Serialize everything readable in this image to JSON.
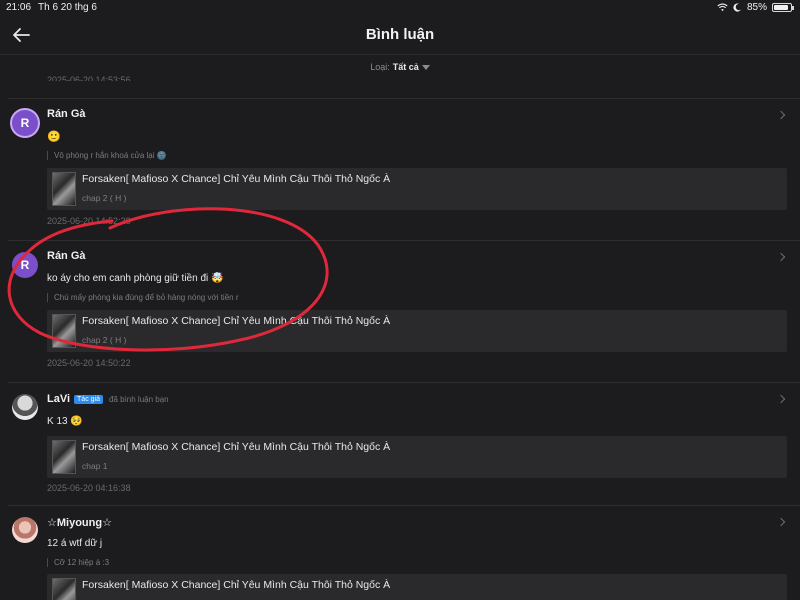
{
  "status_bar": {
    "time": "21:06",
    "date": "Th 6 20 thg 6",
    "battery": "85%"
  },
  "header": {
    "title": "Bình luận"
  },
  "filter": {
    "label": "Loại:",
    "value": "Tất cả"
  },
  "partial_timestamp": "2025-06-20 14:53:56",
  "comments": [
    {
      "name": "Rán Gà",
      "avatar_letter": "R",
      "text": "🙂",
      "quote": "Vô phòng r hắn khoá cửa lại 🌚",
      "story": "Forsaken[ Mafioso X Chance] Chỉ Yêu Mình Cậu Thôi Thỏ Ngốc À",
      "chapter": "chap 2 ( H )",
      "timestamp": "2025-06-20 14:52:28"
    },
    {
      "name": "Rán Gà",
      "avatar_letter": "R",
      "text": "ko áy cho em canh phòng giữ tiền đi 🤯",
      "quote": "Chú mấy phòng kia đúng để bỏ hàng nóng với tiền r",
      "story": "Forsaken[ Mafioso X Chance] Chỉ Yêu Mình Cậu Thôi Thỏ Ngốc À",
      "chapter": "chap 2 ( H )",
      "timestamp": "2025-06-20 14:50:22"
    },
    {
      "name": "LaVi",
      "badge": "Tác giả",
      "reply_note": "đã bình luận bạn",
      "text": "K 13 🥺",
      "story": "Forsaken[ Mafioso X Chance] Chỉ Yêu Mình Cậu Thôi Thỏ Ngốc À",
      "chapter": "chap 1",
      "timestamp": "2025-06-20 04:16:38"
    },
    {
      "name": "☆Miyoung☆",
      "text": "12 á wtf dữ j",
      "quote": "Cỡ 12 hiệp á :3",
      "story": "Forsaken[ Mafioso X Chance] Chỉ Yêu Mình Cậu Thôi Thỏ Ngốc À"
    }
  ],
  "colors": {
    "background": "#1c1c1e",
    "card": "#2a2a2c",
    "annotation": "#e0283a",
    "avatar": "#7b4fc9",
    "badge": "#2d8cf0"
  }
}
